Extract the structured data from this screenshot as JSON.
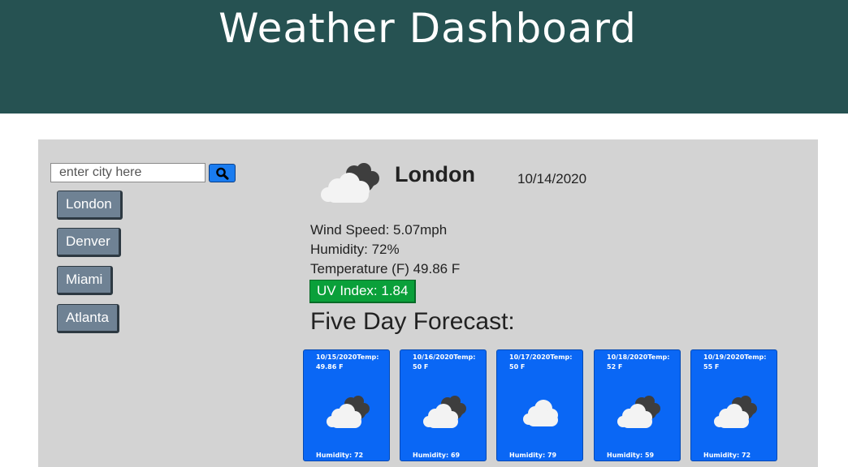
{
  "header": {
    "title": "Weather Dashboard"
  },
  "colors": {
    "header_bg": "#265252",
    "panel_bg": "#d3d3d3",
    "search_button": "#1a7cf0",
    "city_button": "#6f8294",
    "uv_good": "#0aa03a",
    "card_bg": "#0a67f5"
  },
  "search": {
    "placeholder": "enter city here",
    "value": "",
    "button_icon": "search-icon"
  },
  "history": {
    "items": [
      {
        "label": "London"
      },
      {
        "label": "Denver"
      },
      {
        "label": "Miami"
      },
      {
        "label": "Atlanta"
      }
    ]
  },
  "current": {
    "icon": "partly-cloudy-icon",
    "city": "London",
    "date": "10/14/2020",
    "wind": "Wind Speed: 5.07mph",
    "humidity": "Humidity: 72%",
    "temperature": "Temperature (F) 49.86 F",
    "uv": "UV Index: 1.84"
  },
  "forecast": {
    "title": "Five Day Forecast:",
    "days": [
      {
        "text": "10/15/2020Temp: 49.86 F",
        "humidity": "Humidity: 72",
        "icon": "partly-cloudy-icon"
      },
      {
        "text": "10/16/2020Temp: 50 F",
        "humidity": "Humidity: 69",
        "icon": "partly-cloudy-icon"
      },
      {
        "text": "10/17/2020Temp: 50 F",
        "humidity": "Humidity: 79",
        "icon": "cloud-icon"
      },
      {
        "text": "10/18/2020Temp: 52 F",
        "humidity": "Humidity: 59",
        "icon": "partly-cloudy-icon"
      },
      {
        "text": "10/19/2020Temp: 55 F",
        "humidity": "Humidity: 72",
        "icon": "partly-cloudy-icon"
      }
    ]
  }
}
